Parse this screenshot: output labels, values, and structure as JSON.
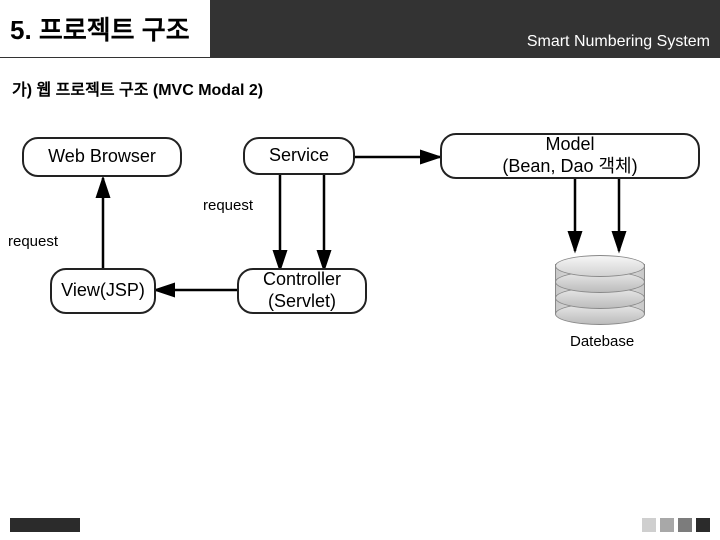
{
  "header": {
    "title": "5. 프로젝트 구조",
    "subtitle": "Smart Numbering System"
  },
  "section": {
    "title": "가) 웹 프로젝트 구조 (MVC Modal 2)"
  },
  "nodes": {
    "web_browser": "Web Browser",
    "service": "Service",
    "model": "Model\n(Bean, Dao 객체)",
    "view": "View(JSP)",
    "controller": "Controller\n(Servlet)"
  },
  "labels": {
    "request_top": "request",
    "request_left": "request",
    "database": "Datebase"
  },
  "footer": {
    "square_colors": [
      "#cfcfcf",
      "#a8a8a8",
      "#7c7c7c",
      "#2b2b2b"
    ]
  }
}
